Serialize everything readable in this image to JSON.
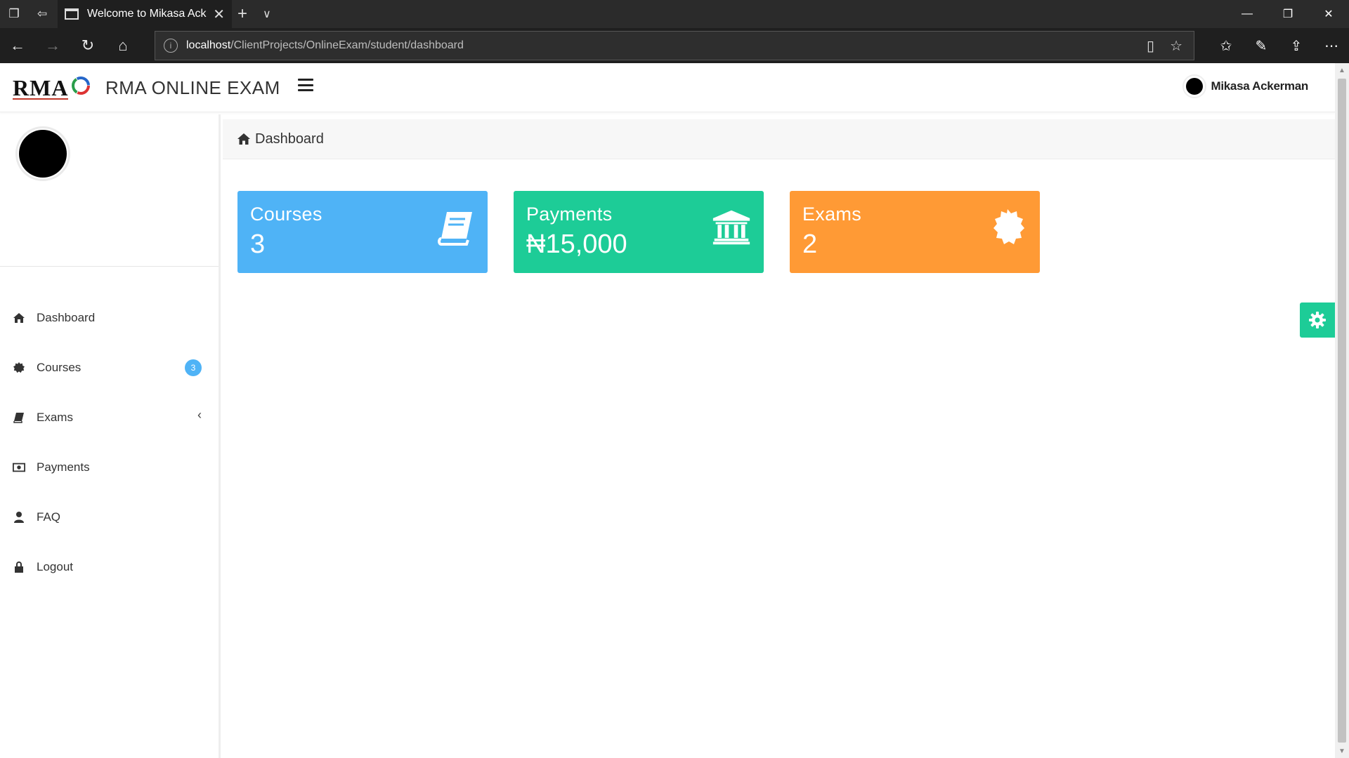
{
  "browser": {
    "tab_title": "Welcome to Mikasa Ack",
    "url_host": "localhost",
    "url_path": "/ClientProjects/OnlineExam/student/dashboard"
  },
  "header": {
    "logo_text": "RMA",
    "brand": "RMA ONLINE EXAM",
    "user_name": "Mikasa Ackerman"
  },
  "sidebar": {
    "items": [
      {
        "label": "Dashboard",
        "icon": "home-icon"
      },
      {
        "label": "Courses",
        "icon": "certificate-icon",
        "badge": "3"
      },
      {
        "label": "Exams",
        "icon": "book-icon"
      },
      {
        "label": "Payments",
        "icon": "money-icon"
      },
      {
        "label": "FAQ",
        "icon": "user-icon"
      },
      {
        "label": "Logout",
        "icon": "lock-icon"
      }
    ]
  },
  "breadcrumb": {
    "title": "Dashboard"
  },
  "cards": [
    {
      "title": "Courses",
      "value": "3",
      "icon": "book-icon",
      "color": "#4fb3f6"
    },
    {
      "title": "Payments",
      "value": "₦15,000",
      "icon": "bank-icon",
      "color": "#1dcc97"
    },
    {
      "title": "Exams",
      "value": "2",
      "icon": "certificate-icon",
      "color": "#ff9a35"
    }
  ],
  "colors": {
    "accent_blue": "#4fb3f6",
    "accent_green": "#1dcc97",
    "accent_orange": "#ff9a35"
  }
}
